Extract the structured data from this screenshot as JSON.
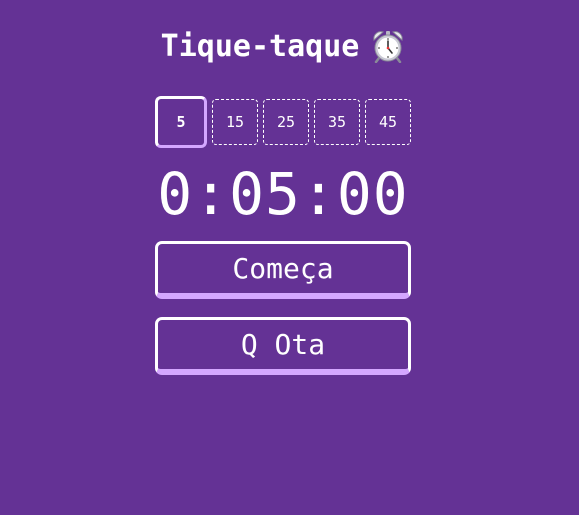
{
  "header": {
    "title": "Tique-taque",
    "icon": "alarm-clock-icon"
  },
  "presets": [
    {
      "label": "5",
      "selected": true
    },
    {
      "label": "15",
      "selected": false
    },
    {
      "label": "25",
      "selected": false
    },
    {
      "label": "35",
      "selected": false
    },
    {
      "label": "45",
      "selected": false
    }
  ],
  "timer": {
    "display": "0:05:00"
  },
  "actions": {
    "start_label": "Começa",
    "reset_label": "Q Ota"
  },
  "colors": {
    "background": "#643295",
    "accent": "#d4a7ff",
    "foreground": "#ffffff"
  }
}
